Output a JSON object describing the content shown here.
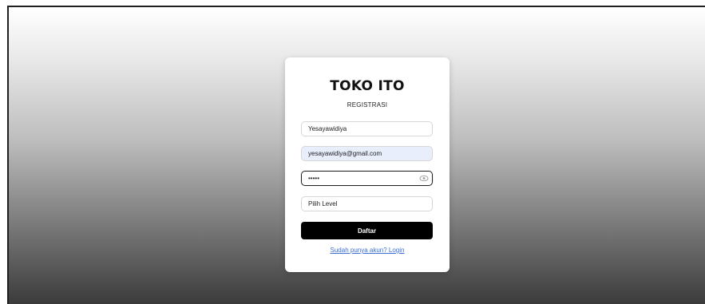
{
  "register_form": {
    "brand": "TOKO ITO",
    "title": "REGISTRASI",
    "username_value": "Yesayawidiya",
    "email_value": "yesayawidiya@gmail.com",
    "password_value": "•••••",
    "level_placeholder": "Pilih Level",
    "submit_label": "Daftar",
    "login_link_label": "Sudah punya akun? Login"
  },
  "icons": {
    "password_toggle": "eye-icon"
  },
  "colors": {
    "button_bg": "#000000",
    "autofill_bg": "#e8eefc",
    "link": "#3b6fd4"
  }
}
